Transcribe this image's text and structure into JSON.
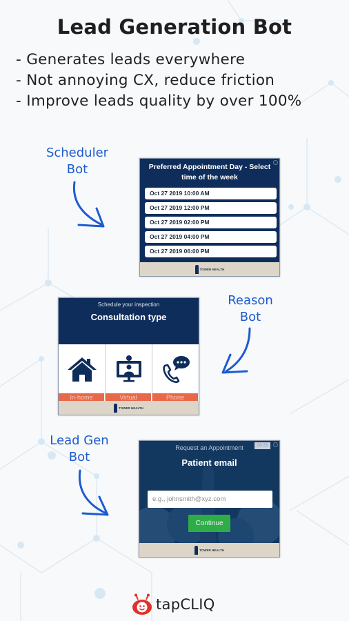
{
  "header": {
    "title": "Lead Generation Bot",
    "bullets": [
      "- Generates leads everywhere",
      "- Not annoying CX, reduce friction",
      "- Improve leads quality by over 100%"
    ]
  },
  "labels": {
    "scheduler": [
      "Scheduler",
      "Bot"
    ],
    "reason": [
      "Reason",
      "Bot"
    ],
    "leadgen": [
      "Lead Gen",
      "Bot"
    ]
  },
  "scheduler_widget": {
    "title": "Preferred Appointment Day - Select time of the week",
    "slots": [
      "Oct 27 2019 10:00 AM",
      "Oct 27 2019 12:00 PM",
      "Oct 27 2019 02:00 PM",
      "Oct 27 2019 04:00 PM",
      "Oct 27 2019 06:00 PM"
    ],
    "footer_brand": "TOWER HEALTH"
  },
  "reason_widget": {
    "subtitle": "Schedule your inspection",
    "title": "Consultation type",
    "options": [
      {
        "label": "In-home",
        "icon": "house-icon"
      },
      {
        "label": "Virtual",
        "icon": "video-call-icon"
      },
      {
        "label": "Phone",
        "icon": "phone-chat-icon"
      }
    ],
    "footer_brand": "TOWER HEALTH"
  },
  "leadgen_widget": {
    "subtitle": "Request an Appointment",
    "timer": "00:23",
    "title": "Patient email",
    "email_placeholder": "e.g., johnsmith@xyz.com",
    "email_value": "",
    "continue_label": "Continue",
    "footer_brand": "TOWER HEALTH"
  },
  "brand": {
    "name": "tapCLIQ",
    "logo_color": "#e0322b"
  },
  "colors": {
    "widget_navy": "#0f2d5b",
    "accent_label_blue": "#1d5bd1",
    "option_orange": "#e8694a",
    "continue_green": "#2eac47",
    "footer_beige": "#ddd6c8"
  }
}
